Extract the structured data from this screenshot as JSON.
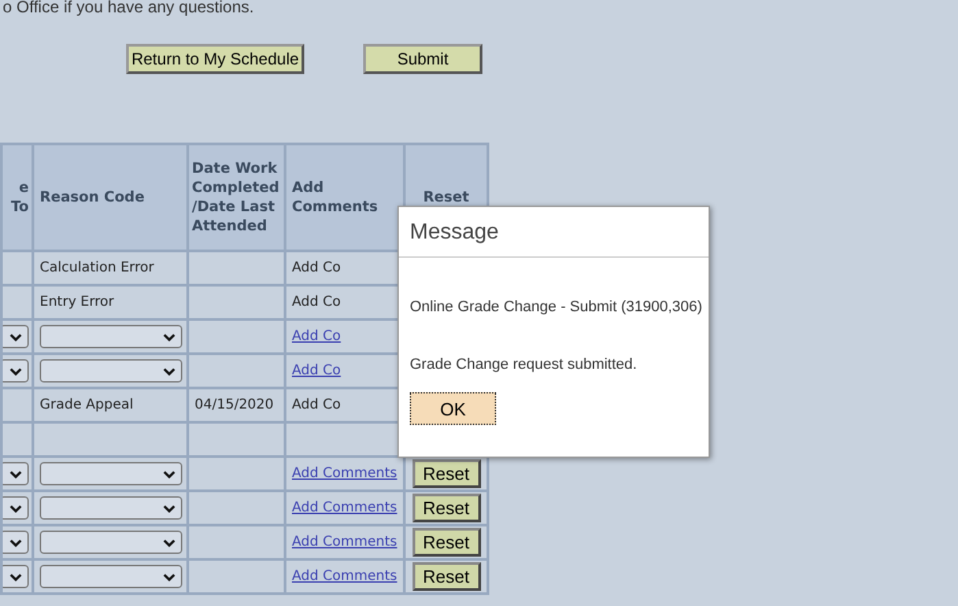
{
  "notice": "o Office if you have any questions.",
  "actions": [
    "Return to My Schedule",
    "Submit"
  ],
  "table": {
    "columns": [
      "e To",
      "Reason Code",
      "Date Work Completed /Date Last Attended",
      "Add Comments",
      "Reset"
    ],
    "rows": [
      {
        "kind": "text",
        "reason": "Calculation Error",
        "comments": "Add Co",
        "comments_link": false
      },
      {
        "kind": "text",
        "reason": "Entry Error",
        "comments": "Add Co",
        "comments_link": false
      },
      {
        "kind": "select",
        "comments": "Add Co",
        "comments_link": true
      },
      {
        "kind": "select",
        "comments": "Add Co",
        "comments_link": true
      },
      {
        "kind": "text",
        "reason": "Grade Appeal",
        "date": "04/15/2020",
        "comments": "Add Co",
        "comments_link": false
      },
      {
        "kind": "blank"
      },
      {
        "kind": "select",
        "comments": "Add Comments",
        "comments_link": true,
        "reset": "Reset"
      },
      {
        "kind": "select",
        "comments": "Add Comments",
        "comments_link": true,
        "reset": "Reset"
      },
      {
        "kind": "select",
        "comments": "Add Comments",
        "comments_link": true,
        "reset": "Reset"
      },
      {
        "kind": "select",
        "comments": "Add Comments",
        "comments_link": true,
        "reset": "Reset"
      }
    ]
  },
  "dialog": {
    "title": "Message",
    "lines": [
      "Online Grade Change - Submit (31900,306)",
      "Grade Change request submitted."
    ],
    "button": "OK"
  }
}
